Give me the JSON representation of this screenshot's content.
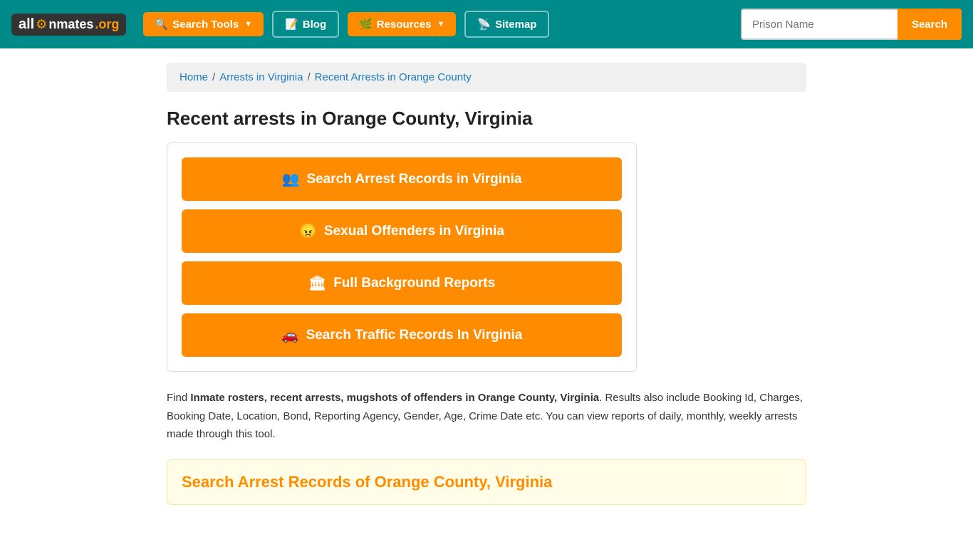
{
  "site": {
    "logo_all": "all",
    "logo_inmates": "Inmates",
    "logo_org": ".org"
  },
  "navbar": {
    "search_tools_label": "Search Tools",
    "blog_label": "Blog",
    "resources_label": "Resources",
    "sitemap_label": "Sitemap",
    "search_placeholder": "Prison Name",
    "search_button_label": "Search"
  },
  "breadcrumb": {
    "home_label": "Home",
    "arrests_va_label": "Arrests in Virginia",
    "current_label": "Recent Arrests in Orange County"
  },
  "page": {
    "title": "Recent arrests in Orange County, Virginia"
  },
  "buttons": {
    "arrest_records": "Search Arrest Records in Virginia",
    "sexual_offenders": "Sexual Offenders in Virginia",
    "background_reports": "Full Background Reports",
    "traffic_records": "Search Traffic Records In Virginia"
  },
  "description": {
    "prefix": "Find ",
    "bold_text": "Inmate rosters, recent arrests, mugshots of offenders in Orange County, Virginia",
    "suffix": ". Results also include Booking Id, Charges, Booking Date, Location, Bond, Reporting Agency, Gender, Age, Crime Date etc. You can view reports of daily, monthly, weekly arrests made through this tool."
  },
  "search_records_section": {
    "title": "Search Arrest Records of Orange County, Virginia"
  }
}
